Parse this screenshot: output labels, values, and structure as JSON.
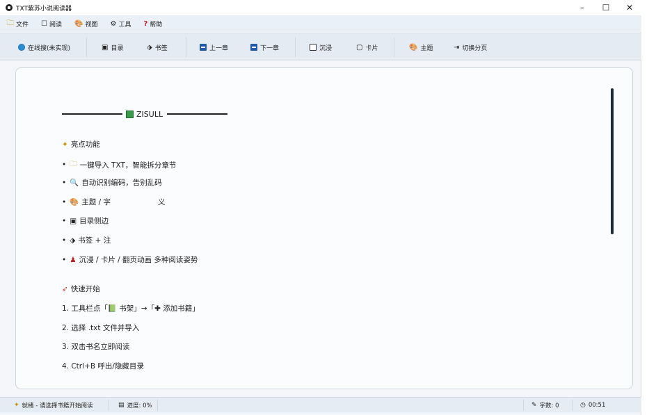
{
  "window": {
    "title": "TXT紫苏小说阅读器",
    "controls": {
      "minimize": "–",
      "maximize": "☐",
      "close": "✕"
    }
  },
  "menu": [
    {
      "label": "文件",
      "icon": "folder-icon",
      "glyph": "🗀"
    },
    {
      "label": "阅读",
      "icon": "square-icon",
      "glyph": "☐"
    },
    {
      "label": "视图",
      "icon": "palette-icon",
      "glyph": "🎨"
    },
    {
      "label": "工具",
      "icon": "gear-icon",
      "glyph": "⚙"
    },
    {
      "label": "帮助",
      "icon": "question-icon",
      "glyph": "?"
    }
  ],
  "toolbar": {
    "online": "在线搜(未实现)",
    "toc": "目录",
    "bookmark": "书签",
    "prev": "上一章",
    "next": "下一章",
    "immersive": "沉浸",
    "card": "卡片",
    "theme": "主题",
    "pagination": "切换分页"
  },
  "content": {
    "banner_title": "ZISULL",
    "highlights_heading": "亮点功能",
    "bullet_char": "•",
    "features": [
      {
        "icon": "folder-icon",
        "glyph": "🗀",
        "text": "一键导入 TXT，智能拆分章节"
      },
      {
        "icon": "magnifier-icon",
        "glyph": "🔍",
        "text": "自动识别编码，告别乱码"
      },
      {
        "icon": "palette-icon",
        "glyph": "🎨",
        "text": "主题 / 字",
        "tail": "义"
      },
      {
        "icon": "document-icon",
        "glyph": "▣",
        "text": "目录侧边"
      },
      {
        "icon": "tag-icon",
        "glyph": "⬗",
        "text": "书签 + 注"
      },
      {
        "icon": "joystick-icon",
        "glyph": "♟",
        "text": "沉浸 / 卡片 / 翻页动画 多种阅读姿势"
      }
    ],
    "quickstart_heading": "快速开始",
    "steps": [
      "1. 工具栏点「📗 书架」→「✚ 添加书籍」",
      "2. 选择 .txt 文件并导入",
      "3. 双击书名立即阅读",
      "4. Ctrl+B 呼出/隐藏目录"
    ]
  },
  "status": {
    "ready": "就绪 - 请选择书籍开始阅读",
    "progress": "进度: 0%",
    "wordcount": "字数: 0",
    "time": "00:51"
  }
}
